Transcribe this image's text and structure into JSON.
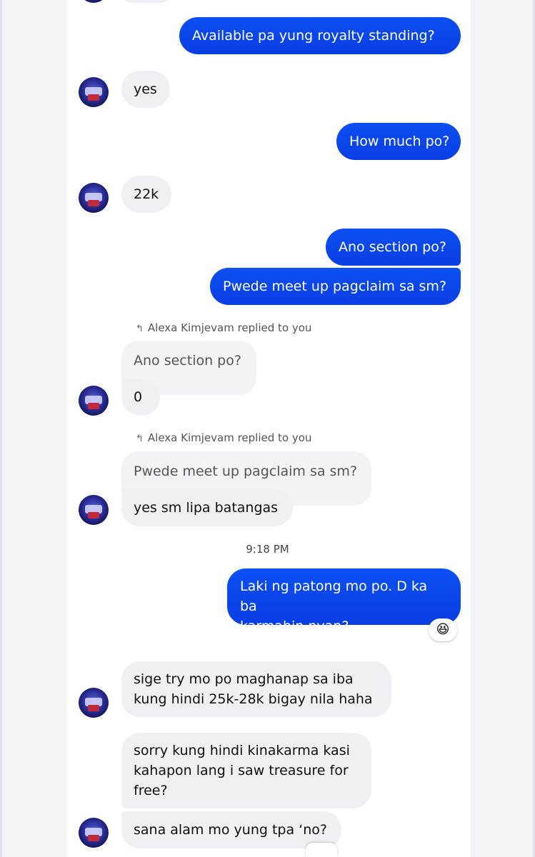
{
  "messages": {
    "m1": "Available pa yung royalty standing?",
    "m2": "yes",
    "m3": "How much po?",
    "m4": "22k",
    "m5": "Ano section po?",
    "m6": "Pwede meet up pagclaim sa sm?",
    "reply1_note": "Alexa Kimjevam replied to you",
    "reply1_quote": "Ano section po?",
    "reply1_answer": "0",
    "reply2_note": "Alexa Kimjevam replied to you",
    "reply2_quote": "Pwede meet up pagclaim sa sm?",
    "reply2_answer": "yes sm lipa batangas",
    "timestamp": "9:18 PM",
    "m7_line1": "Laki ng patong mo po. D ka ba",
    "m7_line2": "karmahin nyan?",
    "m8_line1": "sige try mo po maghanap sa iba",
    "m8_line2": "kung hindi 25k-28k bigay nila haha",
    "m9_line1": "sorry kung hindi kinakarma kasi",
    "m9_line2": "kahapon lang i saw treasure for",
    "m9_line3": "free?",
    "m10": "sana alam mo yung tpa ‘no?"
  },
  "reaction_emoji": "😆",
  "icons": {
    "reply": "reply-arrow-icon",
    "avatar": "contact-avatar"
  },
  "colors": {
    "outgoing_bubble": "#0b4ff2",
    "incoming_bubble": "#efeff4",
    "background": "#ffffff"
  }
}
